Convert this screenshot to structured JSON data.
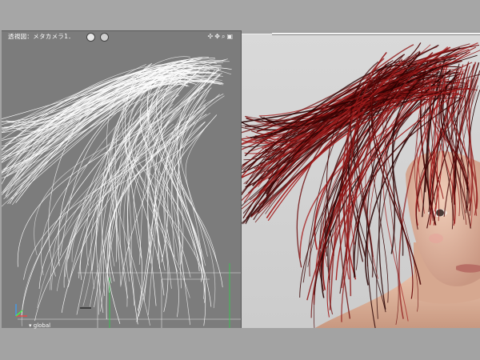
{
  "viewport_left": {
    "title": "透視図：メタカメラ1．",
    "coord_mode": "global",
    "toolbar_icons": [
      "rotate-icon",
      "move-icon",
      "zoom-icon",
      "fit-icon"
    ]
  },
  "viewport_right": {
    "content": "hair-render"
  },
  "colors": {
    "wire": "#ffffff",
    "hair_dark": "#3a0505",
    "hair_red": "#8a1212",
    "skin": "#e2b8a0",
    "render_bg": "#d4d4d4"
  }
}
